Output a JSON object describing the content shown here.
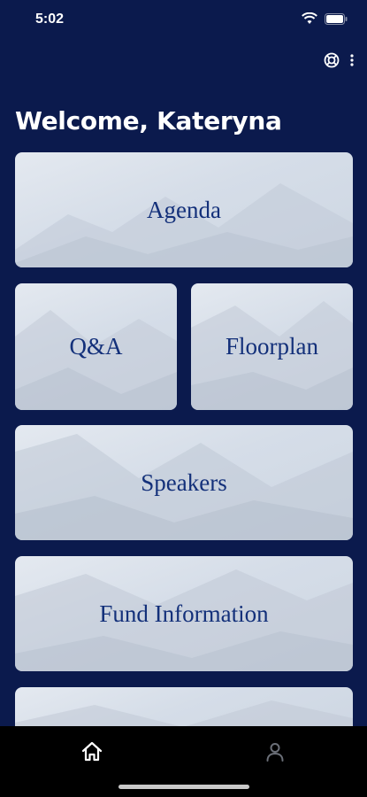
{
  "status": {
    "time": "5:02"
  },
  "header": {
    "welcome": "Welcome, Kateryna"
  },
  "tiles": {
    "agenda": "Agenda",
    "qa": "Q&A",
    "floorplan": "Floorplan",
    "speakers": "Speakers",
    "fund": "Fund Information"
  },
  "colors": {
    "background": "#0b1a4d",
    "tile_text": "#13307a",
    "tab_active": "#ffffff",
    "tab_inactive": "#6b6f78"
  },
  "tabbar": {
    "items": [
      {
        "icon": "home-icon"
      },
      {
        "icon": "person-icon"
      }
    ]
  }
}
